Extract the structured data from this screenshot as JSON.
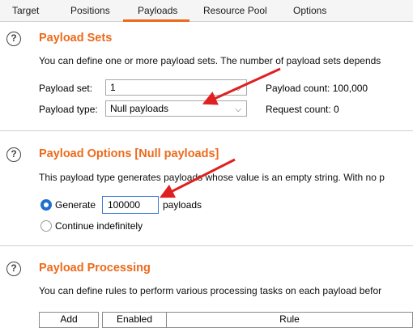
{
  "tabs": [
    {
      "label": "Target"
    },
    {
      "label": "Positions"
    },
    {
      "label": "Payloads"
    },
    {
      "label": "Resource Pool"
    },
    {
      "label": "Options"
    }
  ],
  "active_tab": "Payloads",
  "accent_color": "#ec6a1c",
  "payload_sets": {
    "title": "Payload Sets",
    "description": "You can define one or more payload sets. The number of payload sets depends",
    "set_label": "Payload set:",
    "set_value": "1",
    "type_label": "Payload type:",
    "type_value": "Null payloads",
    "payload_count": "Payload count: 100,000",
    "request_count": "Request count: 0"
  },
  "payload_options": {
    "title": "Payload Options [Null payloads]",
    "description": "This payload type generates payloads whose value is an empty string. With no p",
    "generate_label": "Generate",
    "generate_value": "100000",
    "payloads_suffix": "payloads",
    "continue_label": "Continue indefinitely"
  },
  "payload_processing": {
    "title": "Payload Processing",
    "description": "You can define rules to perform various processing tasks on each payload befor",
    "add_button": "Add",
    "columns": [
      "Enabled",
      "Rule"
    ]
  },
  "help_glyph": "?",
  "chevron_glyph": "⌵"
}
